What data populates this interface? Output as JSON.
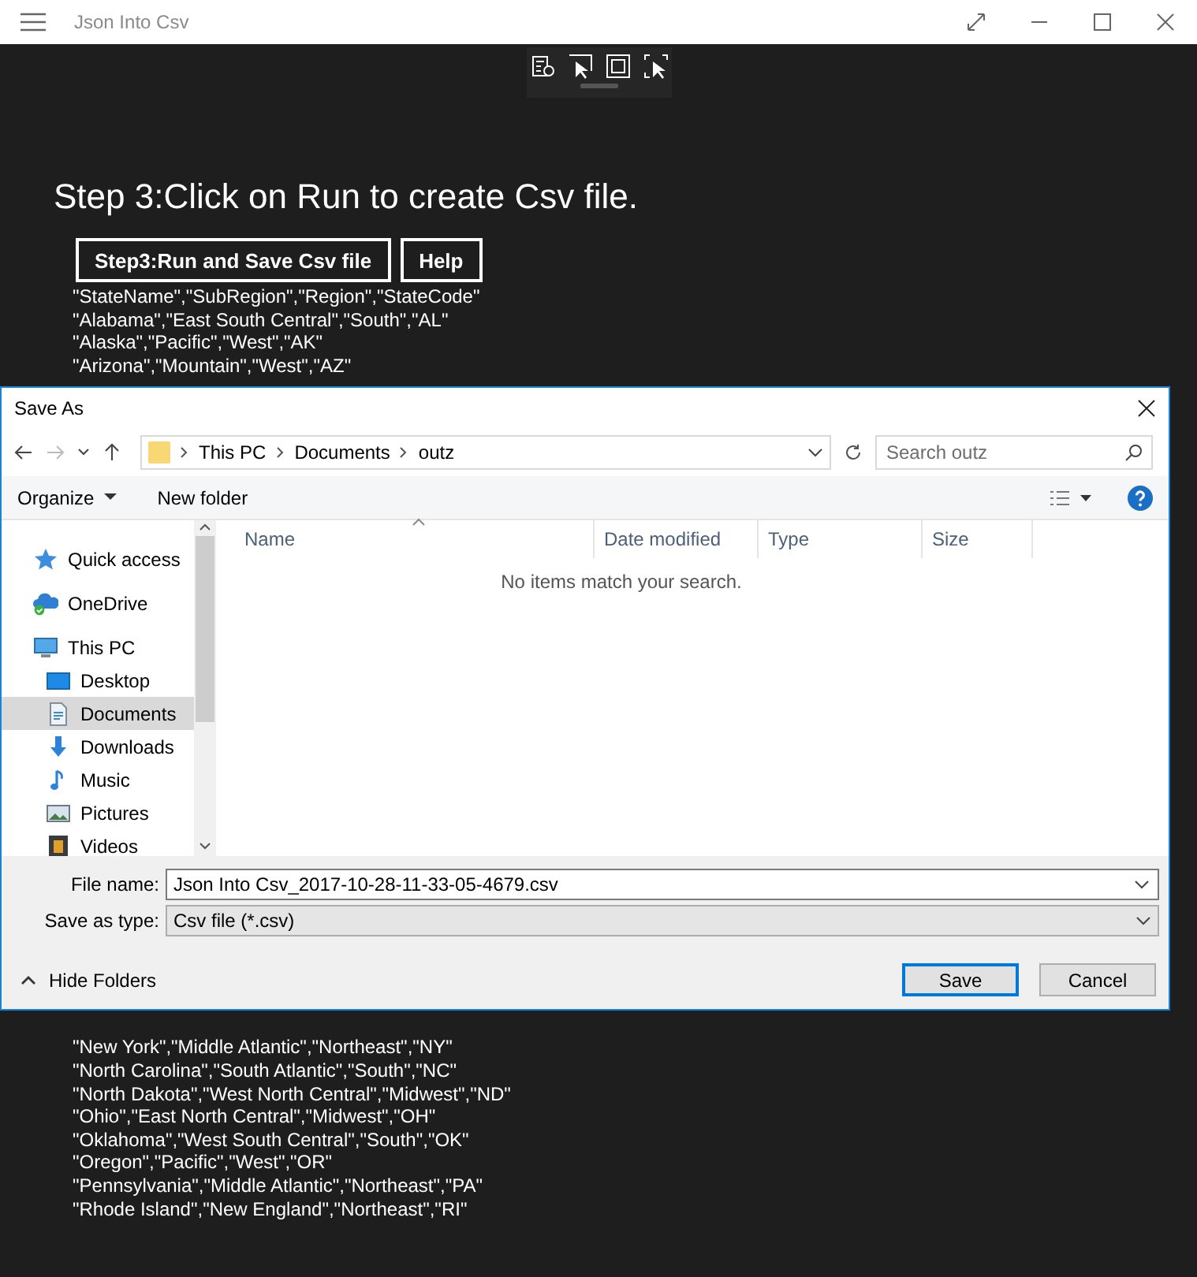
{
  "window": {
    "title": "Json Into Csv"
  },
  "heading": "Step 3:Click on Run to create Csv file.",
  "buttons": [
    {
      "label": "Step3:Run and Save Csv file"
    },
    {
      "label": "Help"
    }
  ],
  "csv_lines_above": [
    "\"StateName\",\"SubRegion\",\"Region\",\"StateCode\"",
    "\"Alabama\",\"East South Central\",\"South\",\"AL\"",
    "\"Alaska\",\"Pacific\",\"West\",\"AK\"",
    "\"Arizona\",\"Mountain\",\"West\",\"AZ\""
  ],
  "csv_lines_below": [
    "\"New York\",\"Middle Atlantic\",\"Northeast\",\"NY\"",
    "\"North Carolina\",\"South Atlantic\",\"South\",\"NC\"",
    "\"North Dakota\",\"West North Central\",\"Midwest\",\"ND\"",
    "\"Ohio\",\"East North Central\",\"Midwest\",\"OH\"",
    "\"Oklahoma\",\"West South Central\",\"South\",\"OK\"",
    "\"Oregon\",\"Pacific\",\"West\",\"OR\"",
    "\"Pennsylvania\",\"Middle Atlantic\",\"Northeast\",\"PA\"",
    "\"Rhode Island\",\"New England\",\"Northeast\",\"RI\""
  ],
  "dialog": {
    "title": "Save As",
    "breadcrumbs": [
      "This PC",
      "Documents",
      "outz"
    ],
    "search": {
      "placeholder": "Search outz"
    },
    "commands": [
      "Organize",
      "New folder"
    ],
    "nav": [
      {
        "label": "Quick access",
        "kind": "star",
        "selected": false
      },
      {
        "label": "OneDrive",
        "kind": "cloud",
        "selected": false
      },
      {
        "label": "This PC",
        "kind": "computer",
        "selected": false,
        "children": [
          {
            "label": "Desktop",
            "kind": "desktop",
            "selected": false
          },
          {
            "label": "Documents",
            "kind": "document",
            "selected": true
          },
          {
            "label": "Downloads",
            "kind": "download",
            "selected": false
          },
          {
            "label": "Music",
            "kind": "music",
            "selected": false
          },
          {
            "label": "Pictures",
            "kind": "pictures",
            "selected": false
          },
          {
            "label": "Videos",
            "kind": "videos",
            "selected": false
          }
        ]
      }
    ],
    "columns": [
      "Name",
      "Date modified",
      "Type",
      "Size"
    ],
    "empty_message": "No items match your search.",
    "file_name": {
      "label": "File name:",
      "value": "Json Into Csv_2017-10-28-11-33-05-4679.csv"
    },
    "save_type": {
      "label": "Save as type:",
      "value": "Csv file (*.csv)"
    },
    "hide_folders": "Hide Folders",
    "actions": [
      {
        "label": "Save",
        "default": true
      },
      {
        "label": "Cancel",
        "default": false
      }
    ]
  }
}
